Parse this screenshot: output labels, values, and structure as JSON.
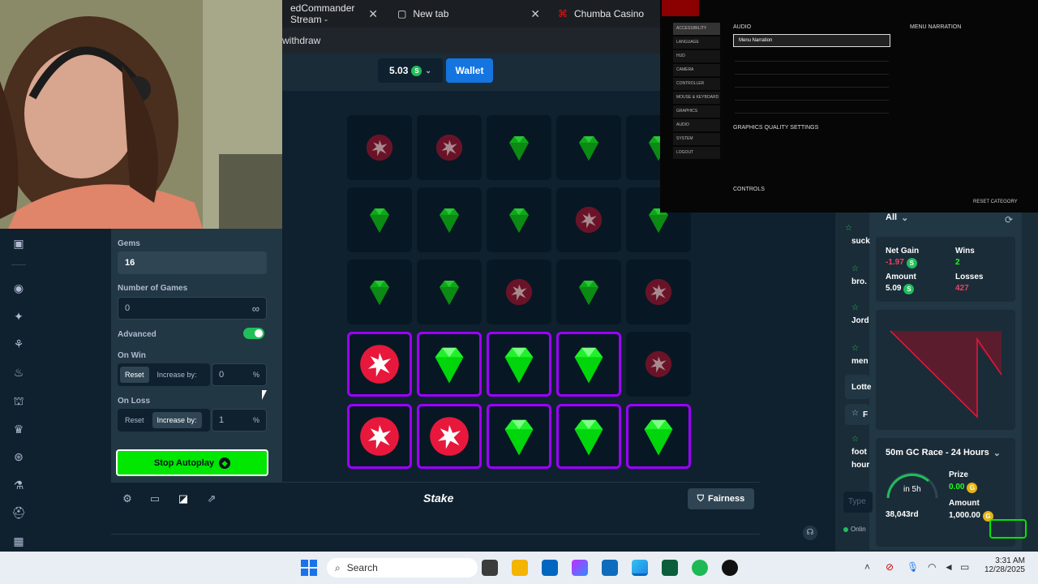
{
  "browser": {
    "tabs": [
      {
        "label": "edCommander Stream -"
      },
      {
        "label": "New tab"
      },
      {
        "label": "Chumba Casino"
      }
    ],
    "address_text": "withdraw"
  },
  "header": {
    "balance": "5.03",
    "coin_letter": "S",
    "wallet_label": "Wallet"
  },
  "panel": {
    "gems_label": "Gems",
    "gems_value": "16",
    "num_games_label": "Number of Games",
    "num_games_value": "0",
    "infinity": "∞",
    "advanced_label": "Advanced",
    "on_win_label": "On Win",
    "on_loss_label": "On Loss",
    "reset_label": "Reset",
    "increase_label": "Increase by:",
    "on_win_value": "0",
    "on_loss_value": "1",
    "percent": "%",
    "stop_autoplay_label": "Stop Autoplay"
  },
  "footer": {
    "logo": "Stake",
    "fairness_label": "Fairness"
  },
  "grid": {
    "rows": [
      [
        "bomb-dim",
        "bomb-dim",
        "gem-dim",
        "gem-dim",
        "gem-dim"
      ],
      [
        "gem-dim",
        "gem-dim",
        "gem-dim",
        "bomb-dim",
        "gem-dim"
      ],
      [
        "gem-dim",
        "gem-dim",
        "bomb-dim",
        "gem-dim",
        "bomb-dim"
      ],
      [
        "bomb-sel",
        "gem-sel",
        "gem-sel",
        "gem-sel",
        "bomb-dim"
      ],
      [
        "bomb-sel",
        "bomb-sel",
        "gem-sel",
        "gem-sel",
        "gem-sel"
      ]
    ]
  },
  "stats": {
    "filter": "All",
    "net_gain_label": "Net Gain",
    "net_gain_value": "-1.97",
    "wins_label": "Wins",
    "wins_value": "2",
    "amount_label": "Amount",
    "amount_value": "5.09",
    "losses_label": "Losses",
    "losses_value": "427",
    "race_title": "50m GC Race - 24 Hours",
    "race_time": "in 5h",
    "race_rank": "38,043rd",
    "prize_label": "Prize",
    "prize_value": "0.00",
    "race_amount_label": "Amount",
    "race_amount_value": "1,000.00",
    "gold_letter": "G"
  },
  "chat": {
    "names": [
      "suck",
      "bro.",
      "Jord",
      "men",
      "Lotte",
      "F",
      "foot",
      "hour"
    ],
    "input_placeholder": "Type",
    "online": "Onlin"
  },
  "overlay": {
    "audio_heading": "AUDIO",
    "menu_narration": "Menu Narration",
    "menu_narration_title": "MENU NARRATION",
    "graphics_heading": "GRAPHICS QUALITY SETTINGS",
    "controls_heading": "CONTROLS",
    "reset_category": "RESET CATEGORY",
    "nav_items": [
      "ACCESSIBILITY",
      "LANGUAGE",
      "HUD",
      "CAMERA",
      "CONTROLLER",
      "MOUSE & KEYBOARD",
      "GRAPHICS",
      "AUDIO",
      "SYSTEM",
      "LOGOUT"
    ]
  },
  "taskbar": {
    "search_label": "Search",
    "time": "3:31 AM",
    "date": "12/28/2025"
  },
  "colors": {
    "gem": "#00e701",
    "bomb": "#e8183c",
    "select_border": "#9d00ff",
    "accent": "#1475e1"
  }
}
